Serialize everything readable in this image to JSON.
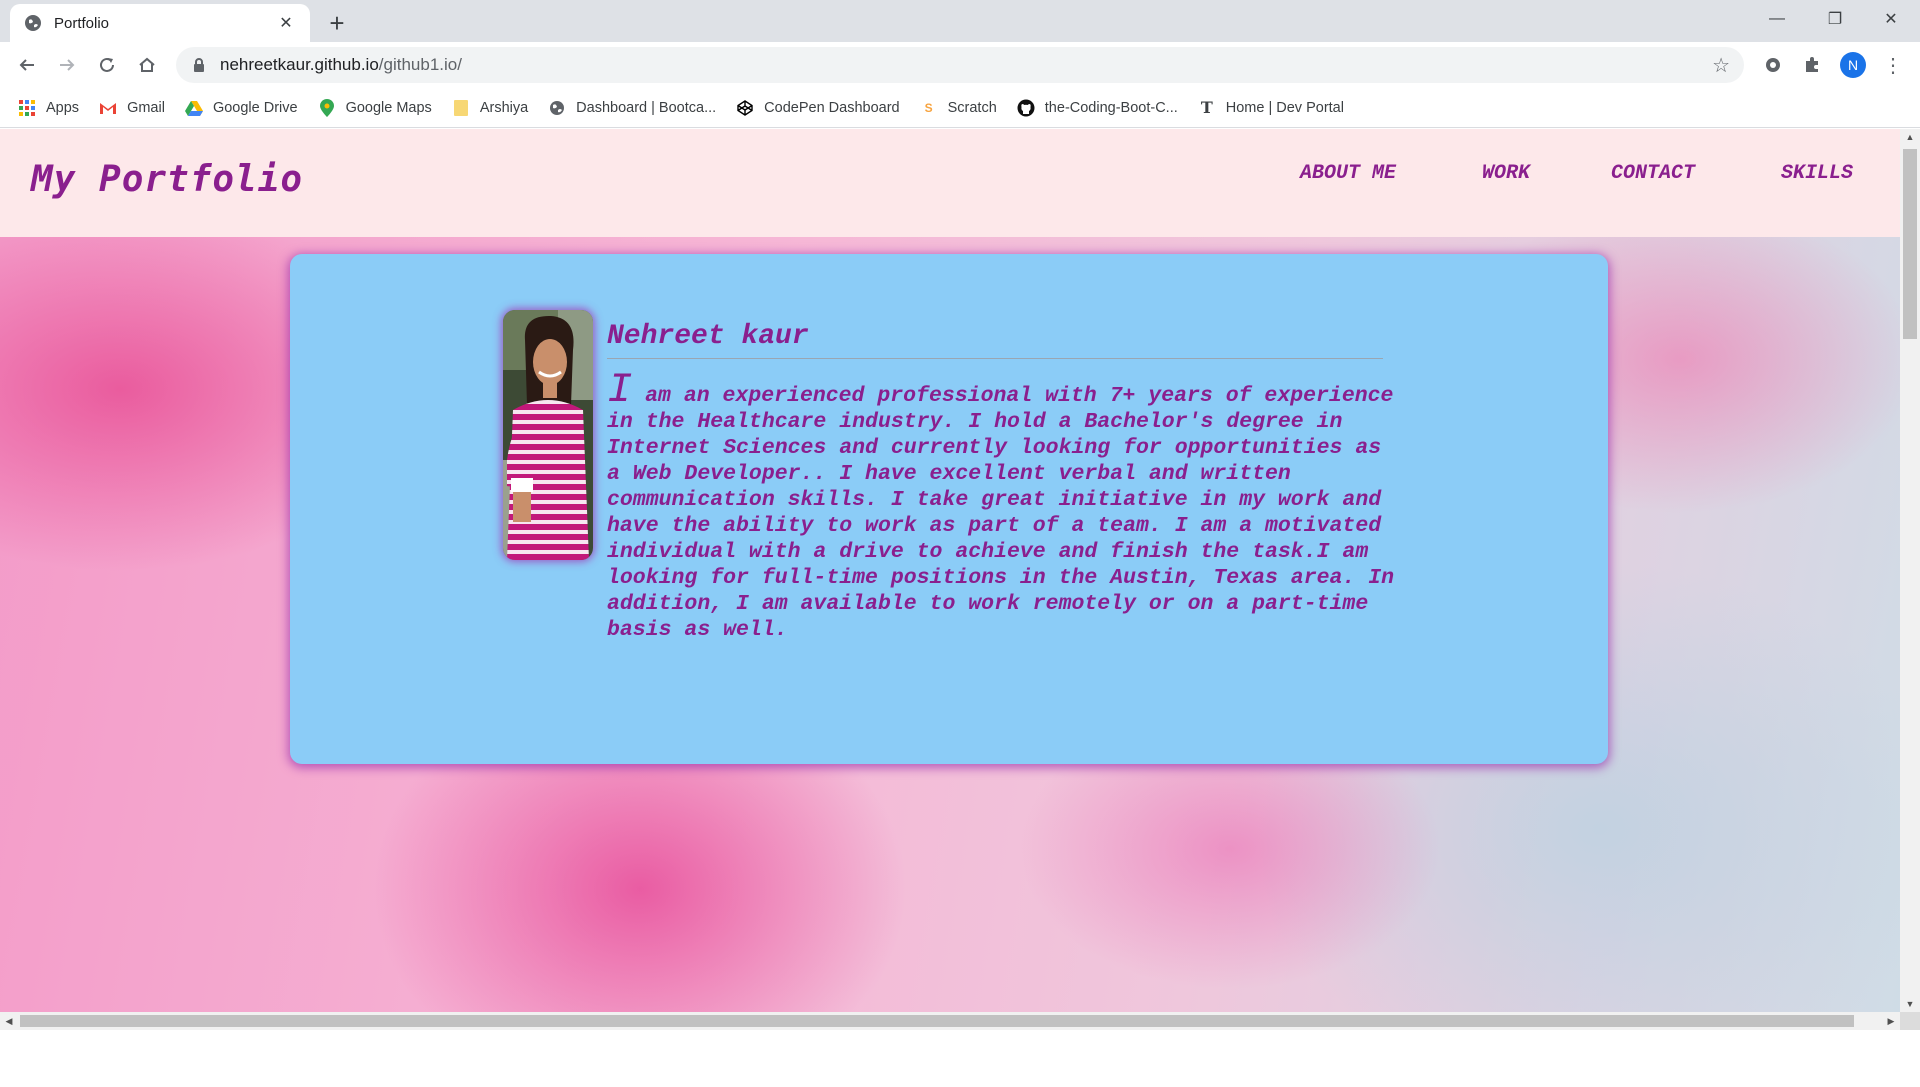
{
  "browser": {
    "tab_title": "Portfolio",
    "tab_close_glyph": "✕",
    "new_tab_glyph": "+",
    "url_host": "nehreetkaur.github.io",
    "url_path": "/github1.io/",
    "profile_initial": "N",
    "window_controls": {
      "minimize": "—",
      "restore": "❐",
      "close": "✕"
    },
    "bookmarks": [
      {
        "label": "Apps",
        "icon": "apps-grid-icon",
        "color": "#4285f4"
      },
      {
        "label": "Gmail",
        "icon": "gmail-icon",
        "color": "#ea4335"
      },
      {
        "label": "Google Drive",
        "icon": "google-drive-icon",
        "color": "#34a853"
      },
      {
        "label": "Google Maps",
        "icon": "google-maps-icon",
        "color": "#4285f4"
      },
      {
        "label": "Arshiya",
        "icon": "folder-icon",
        "color": "#f7d774"
      },
      {
        "label": "Dashboard | Bootca...",
        "icon": "globe-icon",
        "color": "#5f6368"
      },
      {
        "label": "CodePen Dashboard",
        "icon": "codepen-icon",
        "color": "#000000"
      },
      {
        "label": "Scratch",
        "icon": "scratch-icon",
        "color": "#f7a440"
      },
      {
        "label": "the-Coding-Boot-C...",
        "icon": "github-icon",
        "color": "#000000"
      },
      {
        "label": "Home | Dev Portal",
        "icon": "nyt-icon",
        "color": "#000000"
      }
    ]
  },
  "page": {
    "site_title": "My Portfolio",
    "nav": {
      "about": "ABOUT ME",
      "work": "WORK",
      "contact": "CONTACT",
      "skills": "SKILLS"
    },
    "profile": {
      "name": "Nehreet kaur",
      "bio_initial": "I",
      "bio_rest": " am an experienced professional with 7+ years of experience in the Healthcare industry. I hold a Bachelor's degree in Internet Sciences and currently looking for opportunities as a Web Developer.. I have excellent verbal and written communication skills. I take great initiative in my work and have the ability to work as part of a team. I am a motivated individual with a drive to achieve and finish the task.I am looking for full-time positions in the Austin, Texas area. In addition, I am available to work remotely or on a part-time basis as well."
    },
    "colors": {
      "accent_purple": "#8a1f8e",
      "card_blue": "#8bccf7",
      "header_pink": "#fde8ea"
    }
  }
}
